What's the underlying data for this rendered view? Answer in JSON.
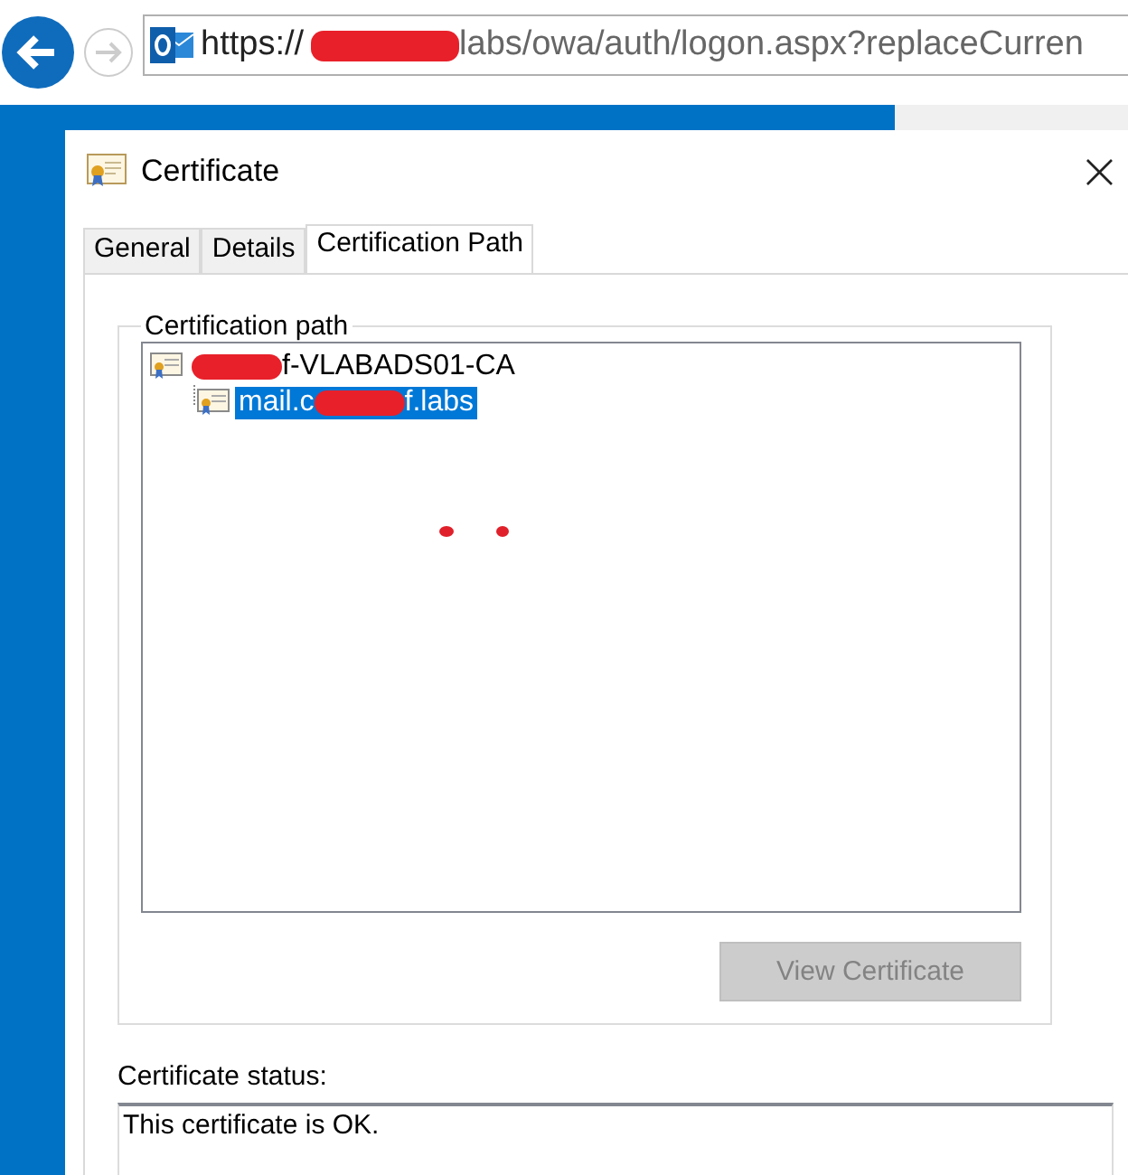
{
  "browser": {
    "url": {
      "scheme": "https://",
      "redacted": true,
      "rest": "labs/owa/auth/logon.aspx?replaceCurren"
    }
  },
  "window": {
    "title": "Certificate",
    "close": "×"
  },
  "tabs": [
    {
      "label": "General",
      "selected": false
    },
    {
      "label": "Details",
      "selected": false
    },
    {
      "label": "Certification Path",
      "selected": true
    }
  ],
  "certification_path": {
    "title": "Certification path",
    "items": [
      {
        "redacted": true,
        "after": "f-VLABADS01-CA",
        "selected": false,
        "children": [
          {
            "before": "mail.c",
            "redacted": true,
            "after": "f.labs",
            "selected": true
          }
        ]
      }
    ]
  },
  "view_button": {
    "label": "View Certificate",
    "disabled": true
  },
  "status": {
    "label": "Certificate status:",
    "value": "This certificate is OK."
  }
}
